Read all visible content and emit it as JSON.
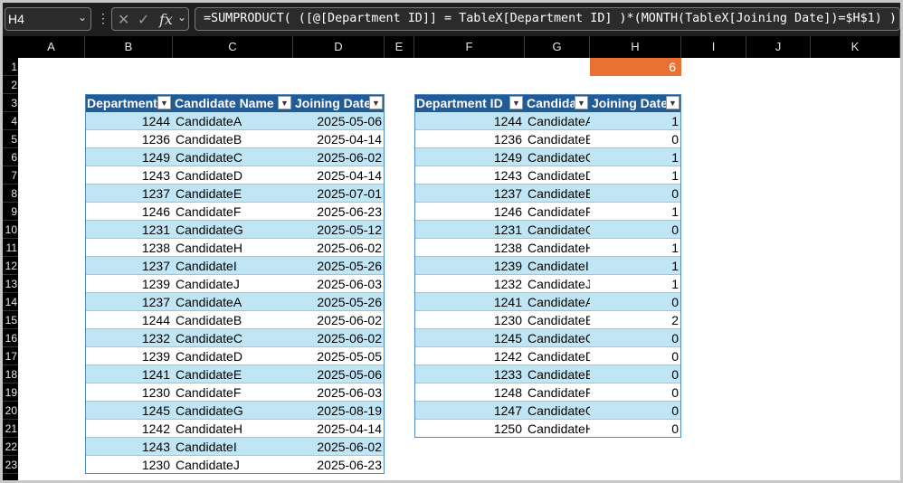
{
  "name_box": "H4",
  "formula": "=SUMPRODUCT( ([@[Department ID]] = TableX[Department ID] )*(MONTH(TableX[Joining Date])=$H$1) )",
  "columns": [
    "A",
    "B",
    "C",
    "D",
    "E",
    "F",
    "G",
    "H",
    "I",
    "J",
    "K"
  ],
  "rows": [
    "1",
    "2",
    "3",
    "4",
    "5",
    "6",
    "7",
    "8",
    "9",
    "10",
    "11",
    "12",
    "13",
    "14",
    "15",
    "16",
    "17",
    "18",
    "19",
    "20",
    "21",
    "22",
    "23"
  ],
  "h1_value": "6",
  "table_left": {
    "headers": [
      "Department",
      "Candidate Name",
      "Joining Date"
    ],
    "rows": [
      [
        "1244",
        "CandidateA",
        "2025-05-06"
      ],
      [
        "1236",
        "CandidateB",
        "2025-04-14"
      ],
      [
        "1249",
        "CandidateC",
        "2025-06-02"
      ],
      [
        "1243",
        "CandidateD",
        "2025-04-14"
      ],
      [
        "1237",
        "CandidateE",
        "2025-07-01"
      ],
      [
        "1246",
        "CandidateF",
        "2025-06-23"
      ],
      [
        "1231",
        "CandidateG",
        "2025-05-12"
      ],
      [
        "1238",
        "CandidateH",
        "2025-06-02"
      ],
      [
        "1237",
        "CandidateI",
        "2025-05-26"
      ],
      [
        "1239",
        "CandidateJ",
        "2025-06-03"
      ],
      [
        "1237",
        "CandidateA",
        "2025-05-26"
      ],
      [
        "1244",
        "CandidateB",
        "2025-06-02"
      ],
      [
        "1232",
        "CandidateC",
        "2025-06-02"
      ],
      [
        "1239",
        "CandidateD",
        "2025-05-05"
      ],
      [
        "1241",
        "CandidateE",
        "2025-05-06"
      ],
      [
        "1230",
        "CandidateF",
        "2025-06-03"
      ],
      [
        "1245",
        "CandidateG",
        "2025-08-19"
      ],
      [
        "1242",
        "CandidateH",
        "2025-04-14"
      ],
      [
        "1243",
        "CandidateI",
        "2025-06-02"
      ],
      [
        "1230",
        "CandidateJ",
        "2025-06-23"
      ]
    ]
  },
  "table_right": {
    "headers": [
      "Department ID",
      "Candida",
      "Joining Date"
    ],
    "rows": [
      [
        "1244",
        "CandidateA",
        "1"
      ],
      [
        "1236",
        "CandidateB",
        "0"
      ],
      [
        "1249",
        "CandidateC",
        "1"
      ],
      [
        "1243",
        "CandidateD",
        "1"
      ],
      [
        "1237",
        "CandidateE",
        "0"
      ],
      [
        "1246",
        "CandidateF",
        "1"
      ],
      [
        "1231",
        "CandidateG",
        "0"
      ],
      [
        "1238",
        "CandidateH",
        "1"
      ],
      [
        "1239",
        "CandidateI",
        "1"
      ],
      [
        "1232",
        "CandidateJ",
        "1"
      ],
      [
        "1241",
        "CandidateA",
        "0"
      ],
      [
        "1230",
        "CandidateB",
        "2"
      ],
      [
        "1245",
        "CandidateC",
        "0"
      ],
      [
        "1242",
        "CandidateD",
        "0"
      ],
      [
        "1233",
        "CandidateE",
        "0"
      ],
      [
        "1248",
        "CandidateF",
        "0"
      ],
      [
        "1247",
        "CandidateG",
        "0"
      ],
      [
        "1250",
        "CandidateH",
        "0"
      ]
    ]
  },
  "colors": {
    "header_blue": "#215c98",
    "band": "#c0e6f5",
    "accent_orange": "#e97132"
  }
}
